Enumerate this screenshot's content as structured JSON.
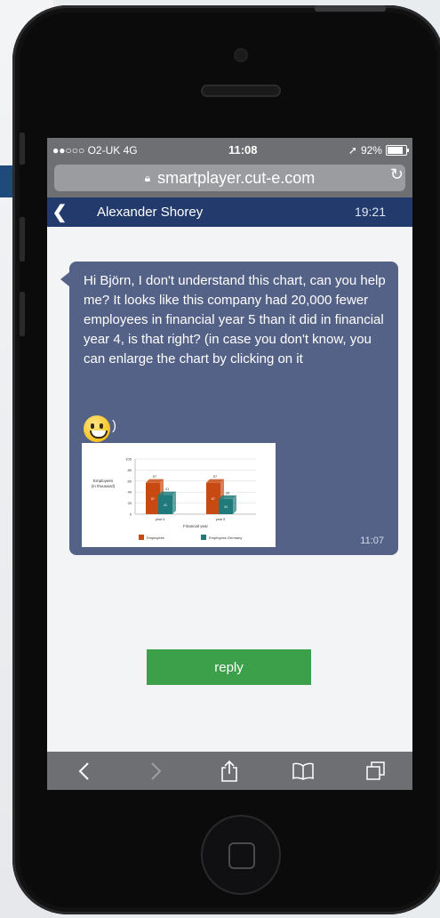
{
  "status": {
    "carrier": "●●○○○ O2-UK  4G",
    "time": "11:08",
    "battery": "92%"
  },
  "browser": {
    "url": "smartplayer.cut-e.com"
  },
  "chat": {
    "contact": "Alexander Shorey",
    "header_time": "19:21",
    "message_text": "Hi Björn, I don't understand this chart, can you help me? It looks like this company had 20,000 fewer employees in financial year 5 than it did in financial year 4, is that right? (in case you don't know, you can enlarge the chart by clicking on it",
    "emoji_trail": ")",
    "message_time": "11:07",
    "reply_label": "reply"
  },
  "chart_data": {
    "type": "bar",
    "categories": [
      "year 4",
      "year 5"
    ],
    "series": [
      {
        "name": "Employees",
        "values": [
          57,
          57
        ]
      },
      {
        "name": "Employees Germany",
        "values": [
          41,
          34
        ]
      }
    ],
    "data_labels": [
      "57",
      "41",
      "57",
      "34"
    ],
    "ylabel": "Employees\n(in thousand)",
    "xlabel": "Financial year",
    "ylim": [
      0,
      100
    ],
    "yticks": [
      "100",
      "80",
      "60",
      "40",
      "20",
      "0"
    ],
    "colors": [
      "#c84a12",
      "#1f7a7a"
    ]
  }
}
